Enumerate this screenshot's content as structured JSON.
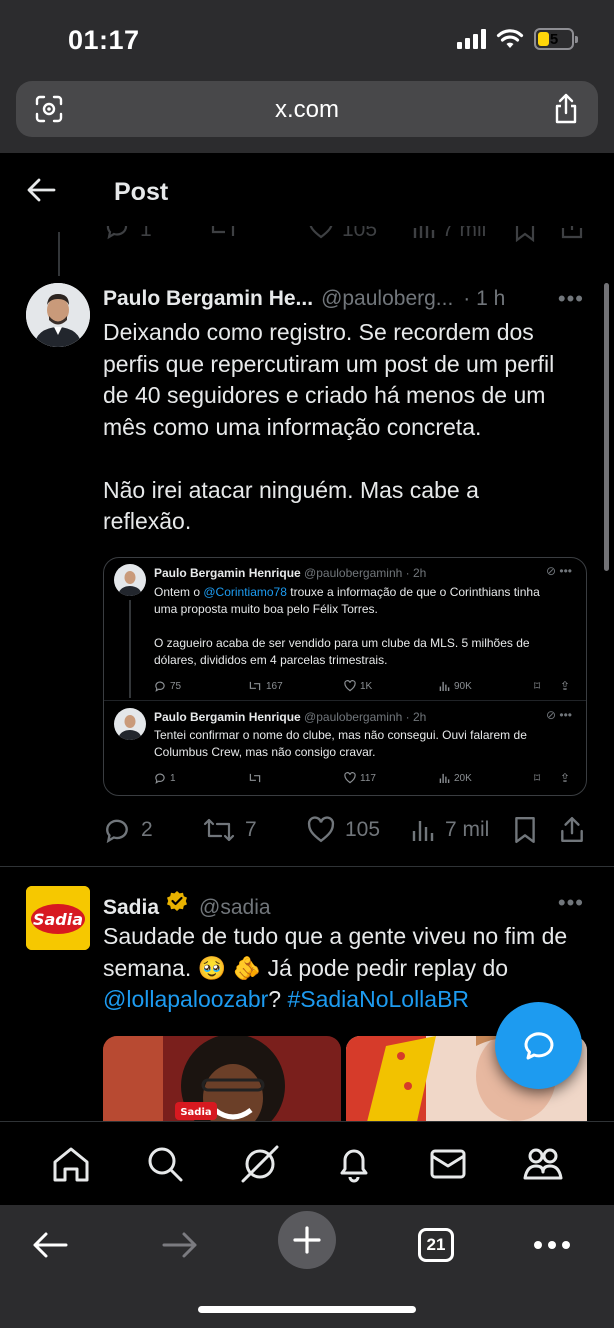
{
  "status_bar": {
    "time": "01:17",
    "battery": "5",
    "battery_color": "#ffd60a"
  },
  "browser": {
    "url": "x.com",
    "tabs_count": "21"
  },
  "header": {
    "title": "Post"
  },
  "main_tweet": {
    "name": "Paulo Bergamin He...",
    "handle": "@pauloberg...",
    "time": "· 1 h",
    "text_lines": [
      "Deixando como registro. Se recordem dos",
      "perfis que repercutiram um post de um perfil",
      "de 40 seguidores e criado há menos de um",
      "mês como uma informação concreta.",
      "",
      "Não irei atacar ninguém. Mas cabe a",
      "reflexão."
    ],
    "replies": "2",
    "retweets": "7",
    "likes": "105",
    "views": "7 mil"
  },
  "quoted": [
    {
      "name": "Paulo Bergamin Henrique",
      "meta": "@paulobergaminh · 2h",
      "text_pre": "Ontem o ",
      "mention": "@Corintiamo78",
      "text_lines": [
        " trouxe a informação de que o Corinthians tinha",
        "uma proposta muito boa pelo Félix Torres.",
        "",
        "O zagueiro acaba de ser vendido para um clube da MLS. 5 milhões de",
        "dólares, divididos em 4 parcelas trimestrais."
      ],
      "replies": "75",
      "retweets": "167",
      "likes": "1K",
      "views": "90K"
    },
    {
      "name": "Paulo Bergamin Henrique",
      "meta": "@paulobergaminh · 2h",
      "text_lines": [
        "Tentei confirmar o nome do clube, mas não consegui. Ouvi falarem de",
        "Columbus Crew, mas não consigo cravar."
      ],
      "replies": "1",
      "retweets": "",
      "likes": "117",
      "views": "20K"
    }
  ],
  "ghost_actions": {
    "replies": "1",
    "likes": "105",
    "views": "7 mil"
  },
  "second_tweet": {
    "name": "Sadia",
    "handle": "@sadia",
    "avatar_text": "Sadia",
    "text_line1": "Saudade de tudo que a gente viveu no fim de",
    "text_line2": "semana. 🥹 🫵 Já pode pedir replay do",
    "mention": "@lollapaloozabr",
    "between": "? ",
    "hashtag": "#SadiaNoLollaBR",
    "media_label": "Sadia"
  },
  "colors": {
    "accent": "#1d9bf0",
    "verified": "#e8b200",
    "background": "#000000"
  }
}
